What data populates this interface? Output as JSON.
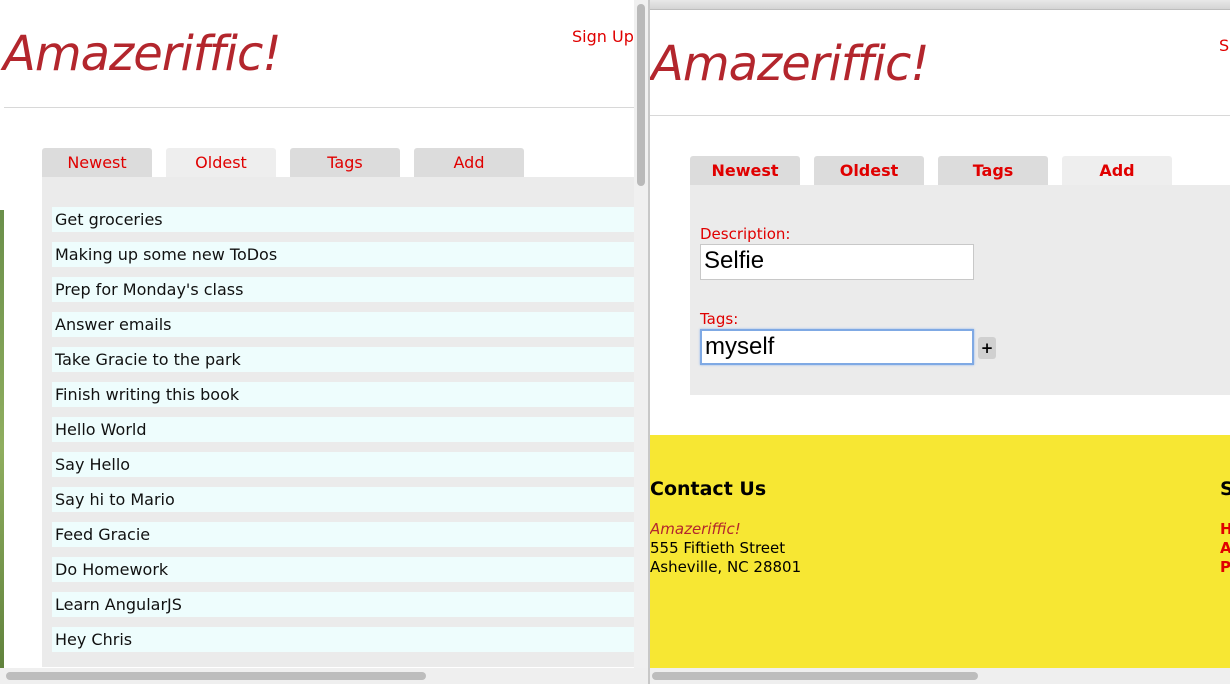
{
  "brand": "Amazeriffic!",
  "left_window": {
    "signup_label": "Sign Up!",
    "tabs": [
      {
        "label": "Newest",
        "active": false
      },
      {
        "label": "Oldest",
        "active": true
      },
      {
        "label": "Tags",
        "active": false
      },
      {
        "label": "Add",
        "active": false
      }
    ],
    "todos": [
      "Get groceries",
      "Making up some new ToDos",
      "Prep for Monday's class",
      "Answer emails",
      "Take Gracie to the park",
      "Finish writing this book",
      "Hello World",
      "Say Hello",
      "Say hi to Mario",
      "Feed Gracie",
      "Do Homework",
      "Learn AngularJS",
      "Hey Chris"
    ]
  },
  "right_window": {
    "signup_label_visible": "S",
    "tabs": [
      {
        "label": "Newest",
        "active": false
      },
      {
        "label": "Oldest",
        "active": false
      },
      {
        "label": "Tags",
        "active": false
      },
      {
        "label": "Add",
        "active": true
      }
    ],
    "add_form": {
      "description_label": "Description:",
      "description_value": "Selfie",
      "tags_label": "Tags:",
      "tags_value": "myself",
      "add_tag_button": "+"
    },
    "footer": {
      "contact_heading": "Contact Us",
      "company": "Amazeriffic!",
      "address_line1": "555 Fiftieth Street",
      "address_line2": "Asheville, NC 28801",
      "sitemap_heading_visible": "S",
      "sitemap_links_visible": [
        "H",
        "A",
        "P"
      ]
    }
  },
  "colors": {
    "brand": "#b3262d",
    "link": "#e00000",
    "panel": "#ebebeb",
    "tab": "#dcdcdc",
    "todo_bg": "#eefdfd",
    "footer_bg": "#f7e733"
  }
}
